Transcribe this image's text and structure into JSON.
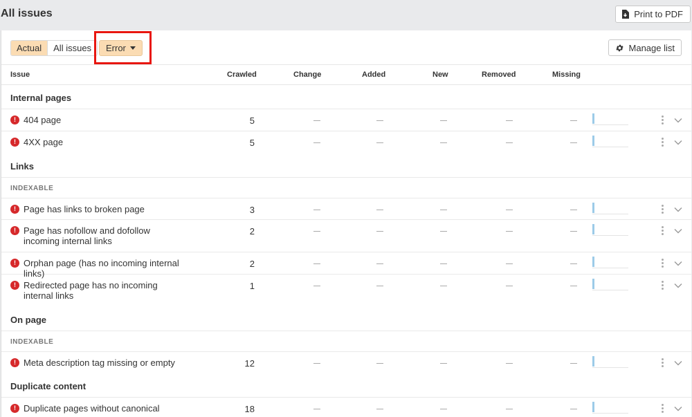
{
  "header": {
    "title": "All issues",
    "print_label": "Print to PDF"
  },
  "filters": {
    "actual_label": "Actual",
    "all_label": "All issues",
    "error_label": "Error"
  },
  "manage_label": "Manage list",
  "columns": {
    "issue": "Issue",
    "crawled": "Crawled",
    "change": "Change",
    "added": "Added",
    "new": "New",
    "removed": "Removed",
    "missing": "Missing"
  },
  "sections": {
    "internal": "Internal pages",
    "links": "Links",
    "links_sub": "INDEXABLE",
    "onpage": "On page",
    "onpage_sub": "INDEXABLE",
    "duplicate": "Duplicate content"
  },
  "issues": [
    {
      "name": "404 page",
      "crawled": "5"
    },
    {
      "name": "4XX page",
      "crawled": "5"
    },
    {
      "name": "Page has links to broken page",
      "crawled": "3"
    },
    {
      "name": "Page has nofollow and dofollow incoming internal links",
      "crawled": "2"
    },
    {
      "name": "Orphan page (has no incoming internal links)",
      "crawled": "2"
    },
    {
      "name": "Redirected page has no incoming internal links",
      "crawled": "1"
    },
    {
      "name": "Meta description tag missing or empty",
      "crawled": "12"
    },
    {
      "name": "Duplicate pages without canonical",
      "crawled": "18"
    }
  ],
  "icons": {
    "print": "pdf-download-icon",
    "manage": "gear-icon",
    "error": "error-icon",
    "more": "kebab-icon",
    "expand": "chevron-down-icon"
  },
  "colors": {
    "accent": "#fbdcb3",
    "error": "#d6292b",
    "highlight": "#e8160f",
    "spark": "#9ccbe8"
  }
}
